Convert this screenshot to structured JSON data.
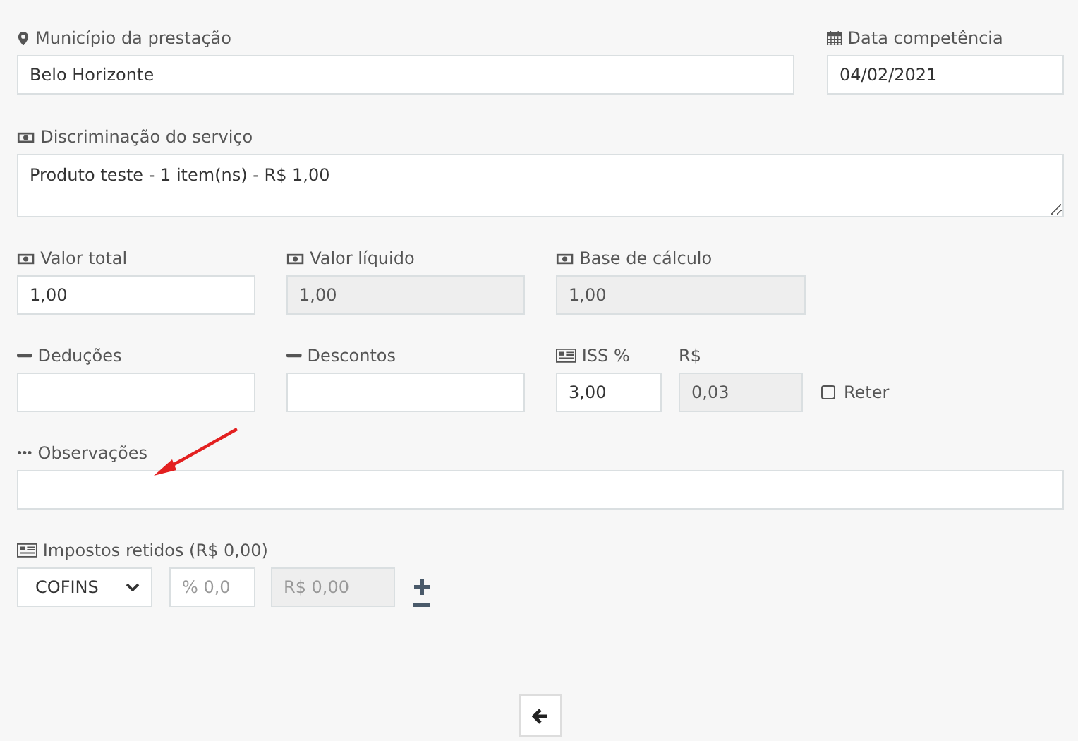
{
  "rows": [
    {
      "fields": [
        {
          "label": "Município da prestação",
          "kind": "input",
          "value": "Belo Horizonte",
          "disabled": false
        },
        {
          "label": "Data competência",
          "kind": "input",
          "value": "04/02/2021",
          "disabled": false
        }
      ]
    },
    {
      "fields": [
        {
          "label": "Discriminação do serviço",
          "kind": "textarea",
          "value": "Produto teste - 1 item(ns) - R$ 1,00",
          "disabled": false
        }
      ]
    },
    {
      "fields": [
        {
          "label": "Valor total",
          "kind": "input",
          "value": "1,00",
          "disabled": false
        },
        {
          "label": "Valor líquido",
          "kind": "input",
          "value": "1,00",
          "disabled": true
        },
        {
          "label": "Base de cálculo",
          "kind": "input",
          "value": "1,00",
          "disabled": true
        }
      ]
    },
    {
      "fields": [
        {
          "label": "Deduções",
          "kind": "input",
          "disabled": false
        },
        {
          "label": "Descontos",
          "kind": "input",
          "disabled": false
        },
        {
          "label": "ISS %",
          "kind": "input",
          "value": "3,00",
          "disabled": false
        },
        {
          "label": "R$",
          "kind": "input",
          "value": "0,03",
          "disabled": true
        }
      ],
      "checkbox": {
        "label": "Reter",
        "checked": false
      }
    },
    {
      "fields": [
        {
          "label": "Observações",
          "kind": "input",
          "disabled": false
        }
      ]
    },
    {
      "fields": [
        {
          "label": "Impostos retidos (R$ 0,00)",
          "kind": "select",
          "value": "COFINS",
          "disabled": false
        },
        {
          "kind": "input",
          "placeholder": "% 0,0",
          "disabled": false
        },
        {
          "kind": "input",
          "placeholder": "R$ 0,00",
          "disabled": true
        }
      ]
    }
  ]
}
